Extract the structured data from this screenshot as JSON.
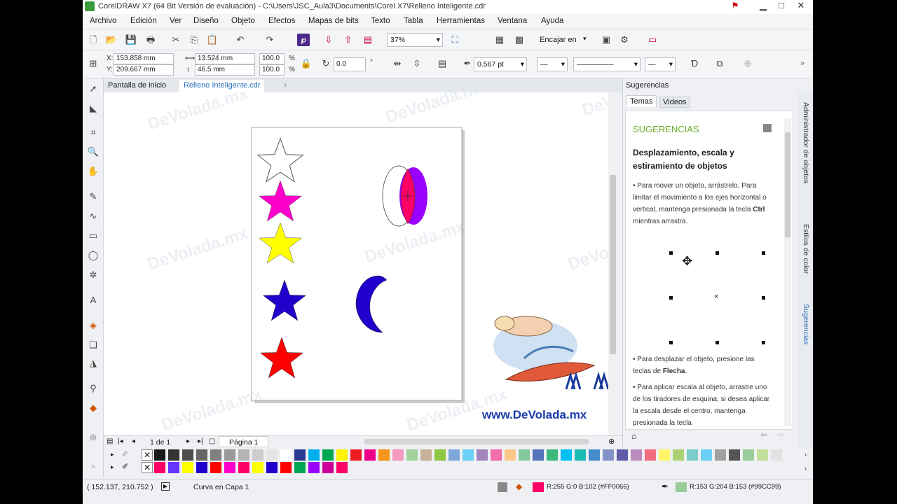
{
  "window": {
    "title": "CorelDRAW X7 (64 Bit Versión de evaluación) - C:\\Users\\JSC_Aula3\\Documents\\Corel X7\\Relleno Inteligente.cdr",
    "controls": [
      "▁",
      "□",
      "✕"
    ]
  },
  "menu": [
    "Archivo",
    "Edición",
    "Ver",
    "Diseño",
    "Objeto",
    "Efectos",
    "Mapas de bits",
    "Texto",
    "Tabla",
    "Herramientas",
    "Ventana",
    "Ayuda"
  ],
  "toolbar": {
    "zoom": "37%",
    "snap_label": "Encajar en"
  },
  "propbar": {
    "x_label": "X:",
    "x_value": "153.858 mm",
    "y_label": "Y:",
    "y_value": "209.667 mm",
    "w_value": "13.524 mm",
    "h_value": "46.5 mm",
    "scale_w": "100.0",
    "scale_h": "100.0",
    "pct": "%",
    "rotation": "0.0",
    "deg": "°",
    "outline_width": "0.567 pt"
  },
  "doc_tabs": [
    "Pantalla de inicio",
    "Relleno Inteligente.cdr"
  ],
  "page_nav": {
    "count": "1 de 1",
    "page_label": "Página 1"
  },
  "docker": {
    "title": "Sugerencias",
    "tabs": [
      "Temas",
      "Videos"
    ],
    "heading": "SUGERENCIAS",
    "topic": "Desplazamiento, escala y estiramiento de objetos",
    "tip1_a": "Para mover un objeto, arrástrelo. Para limitar el movimiento a los ejes horizontal o vertical, mantenga presionada la tecla ",
    "tip1_key": "Ctrl",
    "tip1_b": " mientras arrastra.",
    "tip2_a": "Para desplazar el objeto, presione las teclas de ",
    "tip2_key": "Flecha",
    "tip2_b": ".",
    "tip3": "Para aplicar escala al objeto, arrastre uno de los tiradores de esquina; si desea aplicar la escala desde el centro, mantenga presionada la tecla"
  },
  "side_tabs": [
    "Administrador de objetos",
    "Estilos de color",
    "Sugerencias"
  ],
  "status": {
    "coords": "( 152.137, 210.752 )",
    "object": "Curva en Capa 1",
    "fill_info": "R:255 G:0 B:102 (#FF0066)",
    "outline_info": "R:153 G:204 B:153 (#99CC99)",
    "fill_color": "#FF0066",
    "outline_color": "#99CC99"
  },
  "canvas": {
    "watermark": "DeVolada.mx",
    "logo_text": "www.DeVolada.mx",
    "shape_colors": {
      "star1": "#FFFFFF",
      "star2": "#FF00CC",
      "star3": "#FFFF00",
      "star4": "#2200CC",
      "star5": "#FF0000",
      "ellipse_right": "#9900FF",
      "intersection": "#FF0066",
      "crescent": "#2200CC"
    }
  },
  "palette_row1": [
    "#1a1a1a",
    "#333333",
    "#4d4d4d",
    "#666666",
    "#808080",
    "#999999",
    "#b3b3b3",
    "#cccccc",
    "#e6e6e6",
    "#ffffff",
    "#2b3990",
    "#00aeef",
    "#00a651",
    "#fff200",
    "#ed1c24",
    "#ec008c",
    "#f7941d",
    "#f49ac1",
    "#a3d39c",
    "#c7b299",
    "#8dc63f",
    "#7da7d9",
    "#6dcff6",
    "#a186be",
    "#f06eaa",
    "#fdc689",
    "#82ca9c",
    "#5674b9",
    "#3cb878",
    "#00bff3",
    "#1cbbb4",
    "#448ccb",
    "#8393ca",
    "#605ca8",
    "#bd8cbf",
    "#f26d7d",
    "#fff568",
    "#acd373",
    "#7accc8",
    "#6ecff6",
    "#a0a0a0",
    "#555555",
    "#99cc99",
    "#c4df9b",
    "#e2e2e2"
  ],
  "palette_row2": [
    "#ff0066",
    "#6633ff",
    "#ffff00",
    "#2200cc",
    "#ff0000",
    "#ff00cc",
    "#ff0066",
    "#ffff00",
    "#2200cc",
    "#ff0000",
    "#00a651",
    "#9900ff",
    "#cc0099",
    "#ff0066"
  ]
}
